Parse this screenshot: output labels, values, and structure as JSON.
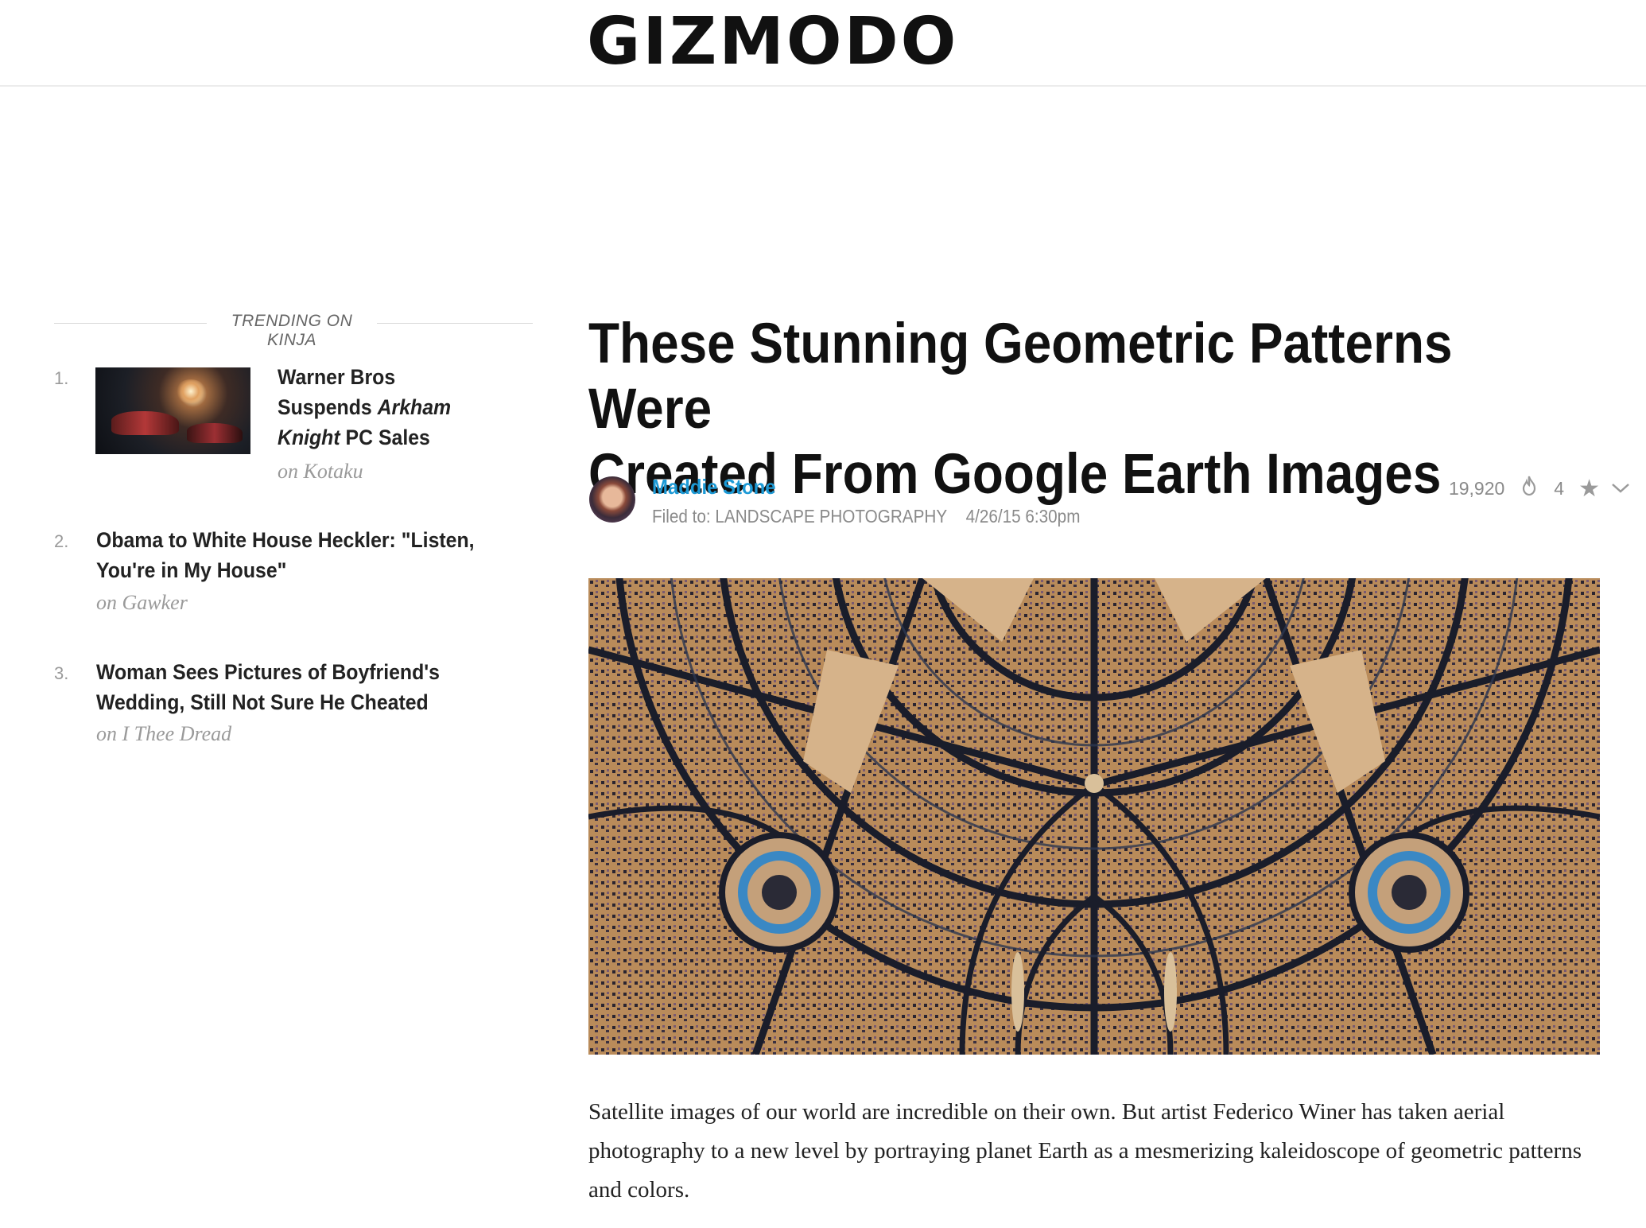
{
  "site": {
    "logo": "GIZMODO"
  },
  "sidebar": {
    "trending_label": "TRENDING ON KINJA",
    "items": [
      {
        "num": "1.",
        "title_parts": [
          "Warner Bros",
          "Suspends ",
          "Arkham",
          "Knight",
          " PC Sales"
        ],
        "source": "on Kotaku",
        "has_thumb": true
      },
      {
        "num": "2.",
        "title_line1": "Obama to White House Heckler: \"Listen,",
        "title_line2": "You're in My House\"",
        "source": "on Gawker"
      },
      {
        "num": "3.",
        "title_line1": "Woman Sees Pictures of Boyfriend's",
        "title_line2": "Wedding, Still Not Sure He Cheated",
        "source": "on I Thee Dread"
      }
    ]
  },
  "article": {
    "headline_line1": "These Stunning Geometric Patterns Were",
    "headline_line2": "Created From Google Earth Images",
    "author": "Maddie Stone",
    "filed_to": "Filed to: LANDSCAPE PHOTOGRAPHY",
    "date": "4/26/15 6:30pm",
    "views": "19,920",
    "comments": "4",
    "body": "Satellite images of our world are incredible on their own. But artist Federico Winer has taken aerial photography to a new level by portraying planet Earth as a mesmerizing kaleidoscope of geometric patterns and colors."
  },
  "colors": {
    "author_link": "#1d9ad6",
    "muted": "#8a8a8a"
  },
  "icons": [
    "flame-icon",
    "star-icon",
    "chevron-down-icon"
  ]
}
